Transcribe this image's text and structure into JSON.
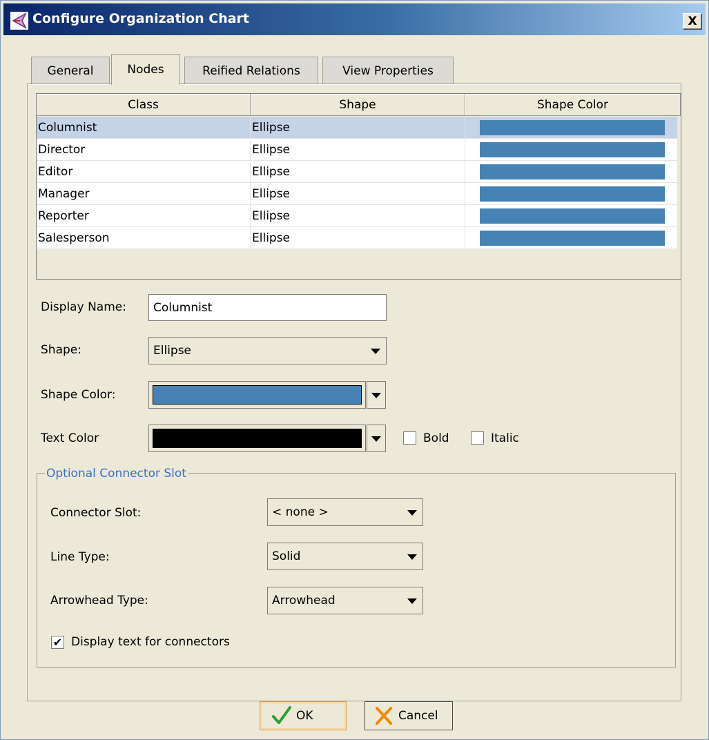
{
  "window": {
    "title": "Configure Organization Chart",
    "close_label": "X"
  },
  "tabs": [
    {
      "label": "General",
      "active": false
    },
    {
      "label": "Nodes",
      "active": true
    },
    {
      "label": "Reified Relations",
      "active": false
    },
    {
      "label": "View Properties",
      "active": false
    }
  ],
  "table": {
    "columns": [
      "Class",
      "Shape",
      "Shape Color"
    ],
    "rows": [
      {
        "class": "Columnist",
        "shape": "Ellipse",
        "color": "#4682b4",
        "selected": true
      },
      {
        "class": "Director",
        "shape": "Ellipse",
        "color": "#4682b4",
        "selected": false
      },
      {
        "class": "Editor",
        "shape": "Ellipse",
        "color": "#4682b4",
        "selected": false
      },
      {
        "class": "Manager",
        "shape": "Ellipse",
        "color": "#4682b4",
        "selected": false
      },
      {
        "class": "Reporter",
        "shape": "Ellipse",
        "color": "#4682b4",
        "selected": false
      },
      {
        "class": "Salesperson",
        "shape": "Ellipse",
        "color": "#4682b4",
        "selected": false
      }
    ]
  },
  "form": {
    "display_name_label": "Display Name:",
    "display_name_value": "Columnist",
    "shape_label": "Shape:",
    "shape_value": "Ellipse",
    "shape_color_label": "Shape Color:",
    "shape_color_value": "#4682b4",
    "text_color_label": "Text Color",
    "text_color_value": "#000000",
    "bold_label": "Bold",
    "bold_checked": false,
    "italic_label": "Italic",
    "italic_checked": false
  },
  "connector": {
    "group_title": "Optional Connector Slot",
    "slot_label": "Connector Slot:",
    "slot_value": "< none >",
    "line_type_label": "Line Type:",
    "line_type_value": "Solid",
    "arrowhead_label": "Arrowhead Type:",
    "arrowhead_value": "Arrowhead",
    "display_text_label": "Display text for connectors",
    "display_text_checked": true
  },
  "buttons": {
    "ok_label": "OK",
    "cancel_label": "Cancel"
  },
  "colors": {
    "title_bar_start": "#0a246a",
    "selected_row": "#c4d3e7",
    "group_title": "#3a6ed0",
    "ok_check": "#2e9e2e",
    "cancel_x": "#f08a00"
  },
  "icons": {
    "app": "org-chart-icon",
    "ok": "checkmark-icon",
    "cancel": "x-icon"
  }
}
